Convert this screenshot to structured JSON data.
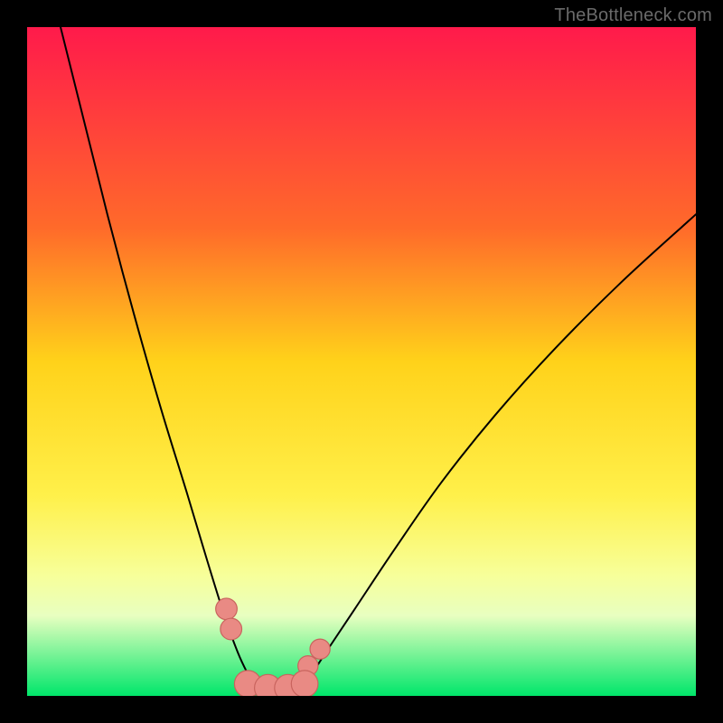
{
  "watermark": "TheBottleneck.com",
  "chart_data": {
    "type": "line",
    "title": "",
    "xlabel": "",
    "ylabel": "",
    "xlim": [
      0,
      100
    ],
    "ylim": [
      0,
      100
    ],
    "grid": false,
    "legend": false,
    "gradient_stops": [
      {
        "y": 100,
        "color": "#ff1a4b"
      },
      {
        "y": 70,
        "color": "#ff6a2a"
      },
      {
        "y": 50,
        "color": "#ffd21a"
      },
      {
        "y": 30,
        "color": "#fff04a"
      },
      {
        "y": 18,
        "color": "#f7ff9a"
      },
      {
        "y": 12,
        "color": "#e8ffc0"
      },
      {
        "y": 0,
        "color": "#00e66a"
      }
    ],
    "series": [
      {
        "name": "left-curve",
        "stroke": "#000000",
        "x": [
          5,
          8,
          12,
          16,
          20,
          24,
          27,
          29.5,
          31.5,
          33,
          34,
          34.8,
          35.2
        ],
        "values": [
          100,
          88,
          72,
          57,
          43,
          30,
          20,
          12,
          6.5,
          3.3,
          1.7,
          0.6,
          0
        ]
      },
      {
        "name": "right-curve",
        "stroke": "#000000",
        "x": [
          40.2,
          41,
          42.5,
          45,
          49,
          55,
          62,
          70,
          79,
          89,
          100
        ],
        "values": [
          0,
          1.2,
          3.2,
          7,
          13,
          22,
          32,
          42,
          52,
          62,
          72
        ]
      },
      {
        "name": "valley-floor",
        "stroke": "#000000",
        "x": [
          35.2,
          36.5,
          38,
          39.5,
          40.2
        ],
        "values": [
          0,
          0,
          0,
          0,
          0
        ]
      }
    ],
    "markers": [
      {
        "name": "left-marker-1",
        "x": 29.8,
        "y": 13.0,
        "r": 1.6
      },
      {
        "name": "left-marker-2",
        "x": 30.5,
        "y": 10.0,
        "r": 1.6
      },
      {
        "name": "right-marker-1",
        "x": 42.0,
        "y": 4.5,
        "r": 1.5
      },
      {
        "name": "right-marker-2",
        "x": 43.8,
        "y": 7.0,
        "r": 1.5
      },
      {
        "name": "floor-blob-1",
        "x": 33.0,
        "y": 1.8,
        "r": 2.0
      },
      {
        "name": "floor-blob-2",
        "x": 36.0,
        "y": 1.2,
        "r": 2.0
      },
      {
        "name": "floor-blob-3",
        "x": 39.0,
        "y": 1.2,
        "r": 2.0
      },
      {
        "name": "floor-blob-4",
        "x": 41.5,
        "y": 1.8,
        "r": 2.0
      }
    ],
    "marker_style": {
      "fill": "#e98a84",
      "stroke": "#c9645e"
    }
  }
}
